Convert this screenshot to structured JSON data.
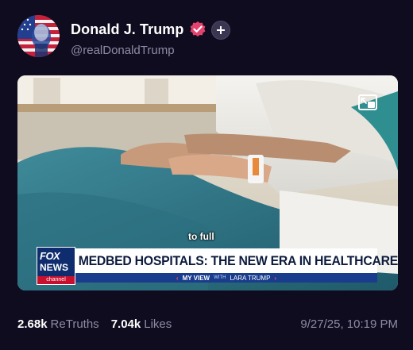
{
  "post": {
    "author": {
      "display_name": "Donald J. Trump",
      "handle": "@realDonaldTrump",
      "verified": true,
      "avatar_icon": "avatar-american-flag-portrait"
    },
    "media": {
      "caption": "to full",
      "network": {
        "logo_line1": "FOX",
        "logo_line2": "NEWS",
        "logo_line3": "channel"
      },
      "headline": "MEDBED HOSPITALS: THE NEW ERA IN HEALTHCARE",
      "segment": {
        "title": "MY VIEW",
        "with": "WITH",
        "host": "LARA TRUMP"
      },
      "pip_icon": "picture-in-picture-icon"
    },
    "stats": {
      "retruths_count": "2.68k",
      "retruths_label": "ReTruths",
      "likes_count": "7.04k",
      "likes_label": "Likes"
    },
    "timestamp": "9/27/25, 10:19 PM"
  },
  "colors": {
    "background": "#100c1f",
    "muted_text": "#8e8aa3",
    "verified_badge": "#e4436f",
    "fox_blue": "#0f2d6e",
    "fox_red": "#c8102e"
  }
}
